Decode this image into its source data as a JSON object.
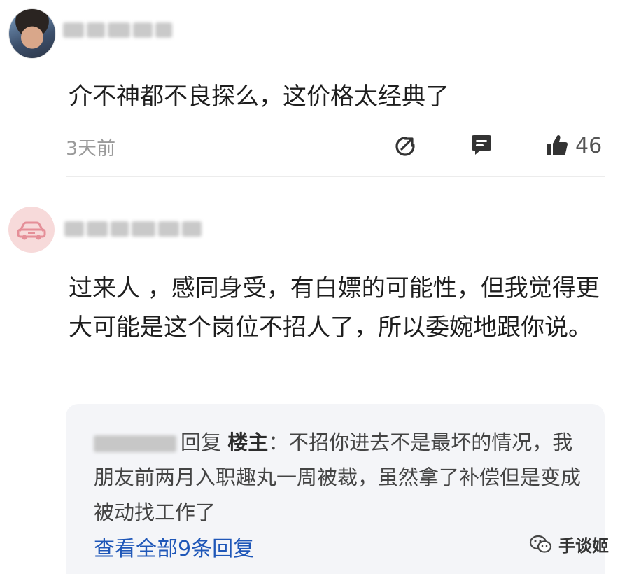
{
  "comments": [
    {
      "text": "介不神都不良探么，这价格太经典了",
      "time": "3天前",
      "likes": "46"
    },
    {
      "text": "过来人 ，感同身受，有白嫖的可能性，但我觉得更大可能是这个岗位不招人了，所以委婉地跟你说。",
      "reply": {
        "reply_label": "回复",
        "op_label": "楼主",
        "text": "：不招你进去不是最坏的情况，我朋友前两月入职趣丸一周被裁，虽然拿了补偿但是变成被动找工作了",
        "view_all": "查看全部9条回复"
      }
    }
  ],
  "watermark": "手谈姬"
}
